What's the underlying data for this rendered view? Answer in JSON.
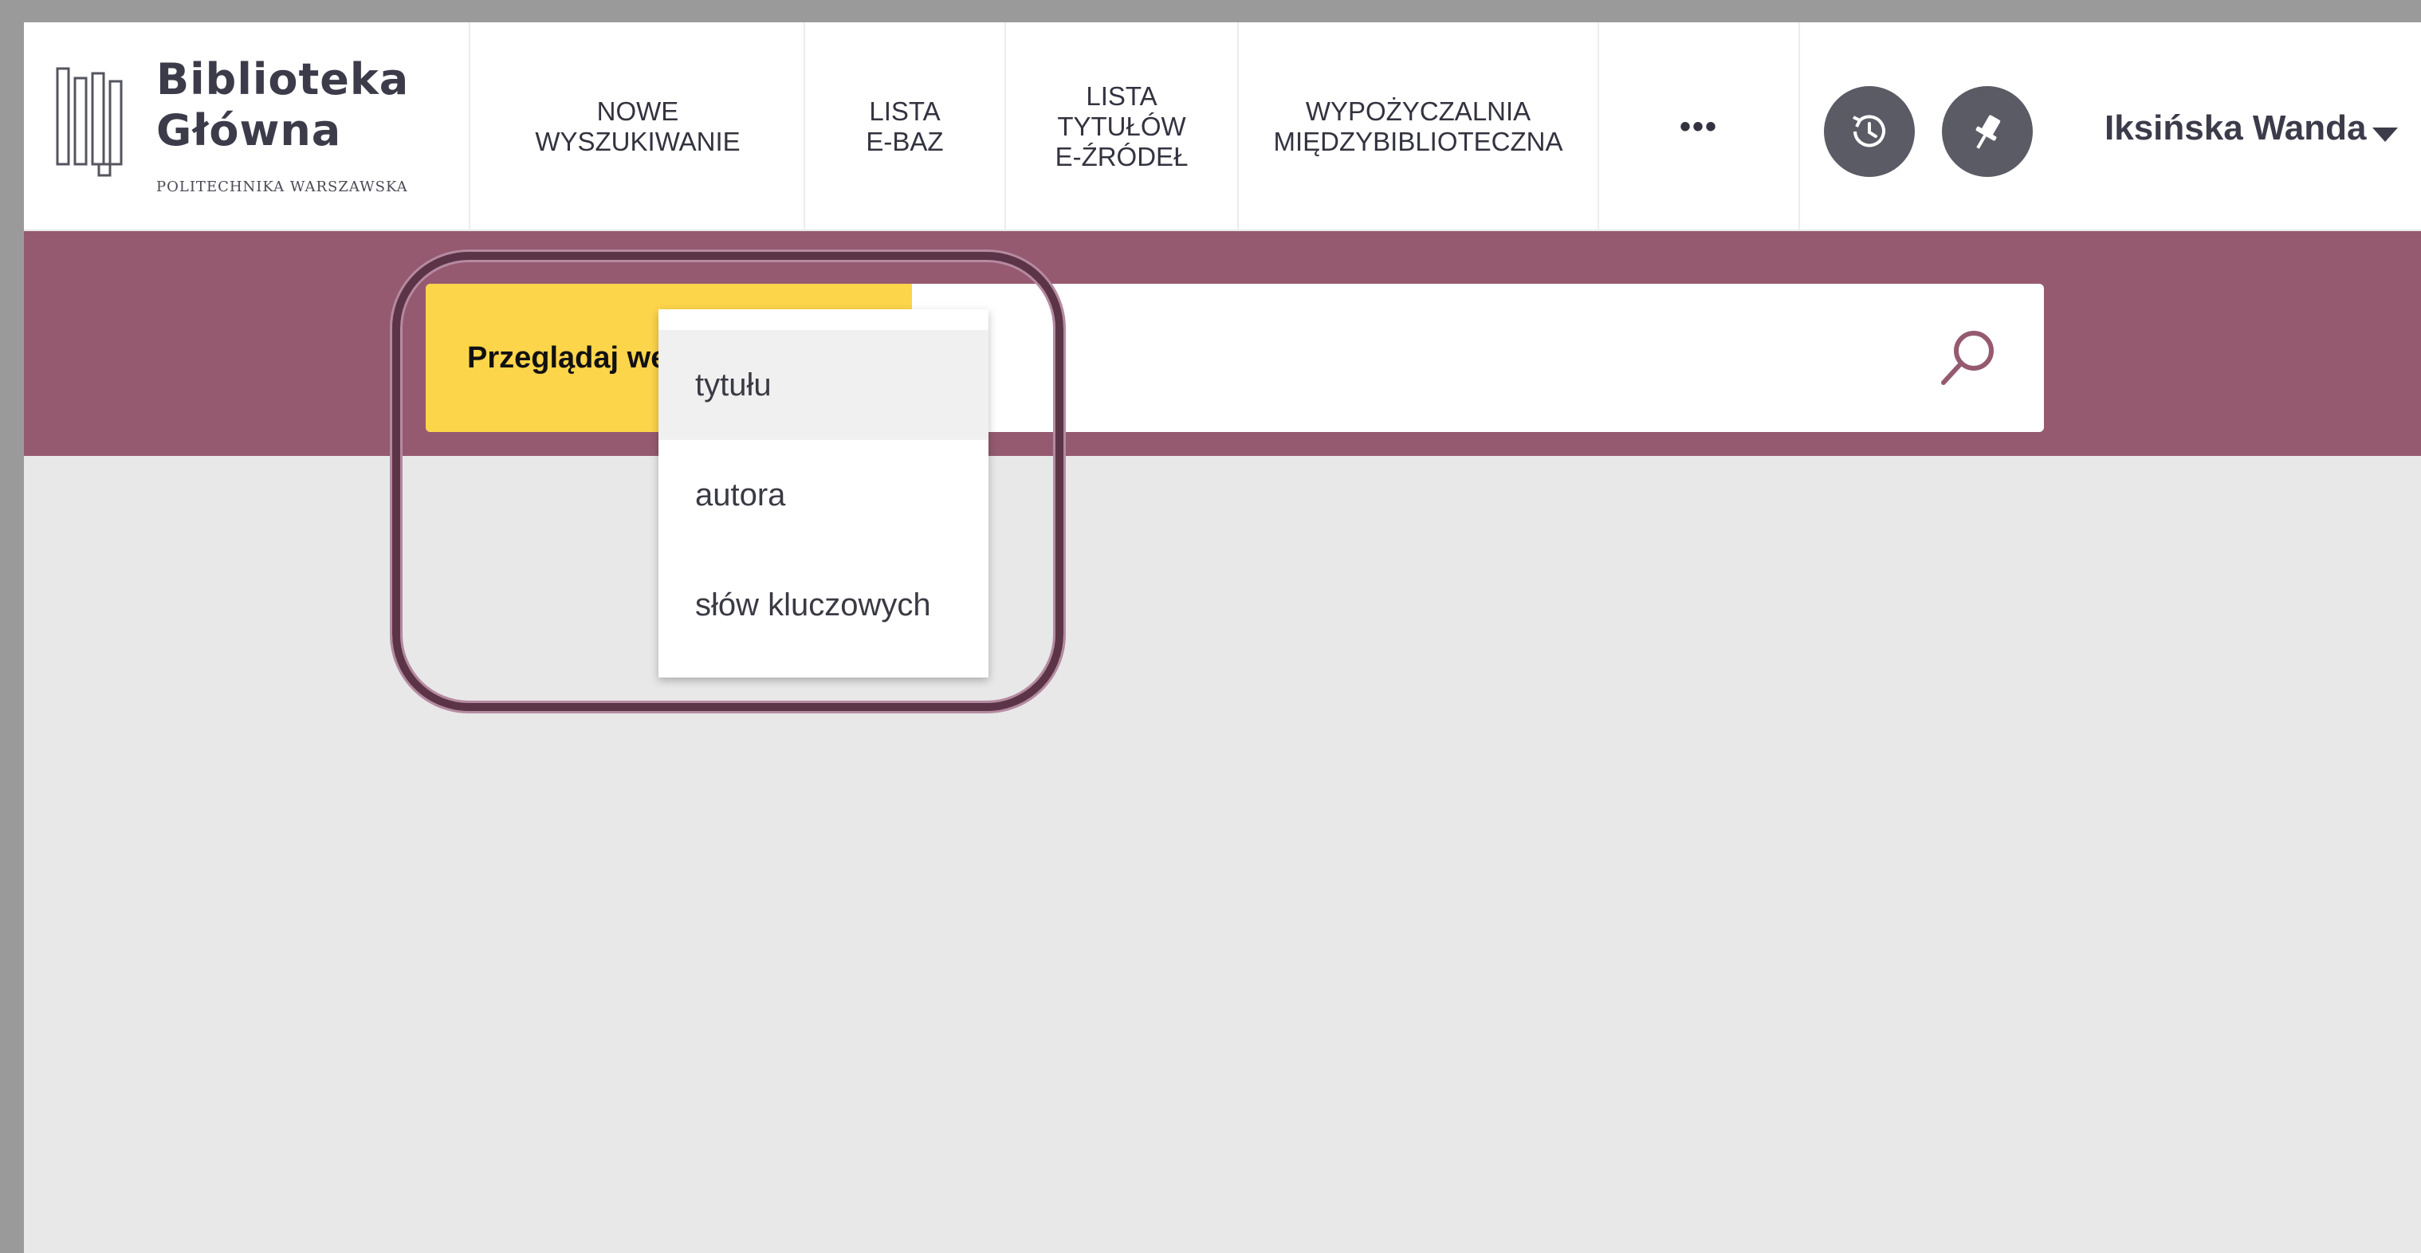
{
  "logo": {
    "line1": "Biblioteka",
    "line2": "Główna",
    "subtitle": "POLITECHNIKA WARSZAWSKA"
  },
  "nav": {
    "items": [
      {
        "label": "NOWE\nWYSZUKIWANIE"
      },
      {
        "label": "LISTA\nE-BAZ"
      },
      {
        "label": "LISTA\nTYTUŁÓW\nE-ŹRÓDEŁ"
      },
      {
        "label": "WYPOŻYCZALNIA\nMIĘDZYBIBLIOTECZNA"
      },
      {
        "label": "•••"
      }
    ]
  },
  "header_icons": {
    "history": "history-icon",
    "pin": "pushpin-icon"
  },
  "user": {
    "name": "Iksińska Wanda"
  },
  "search": {
    "browse_label": "Przeglądaj według",
    "search_icon": "magnifier-icon",
    "dropdown_options": [
      {
        "label": "tytułu",
        "active": true
      },
      {
        "label": "autora",
        "active": false
      },
      {
        "label": "słów kluczowych",
        "active": false
      }
    ]
  },
  "colors": {
    "band": "#955a70",
    "browse_button": "#fdd54a",
    "highlight_frame": "#5c3448",
    "page_bg": "#e8e8e8"
  }
}
